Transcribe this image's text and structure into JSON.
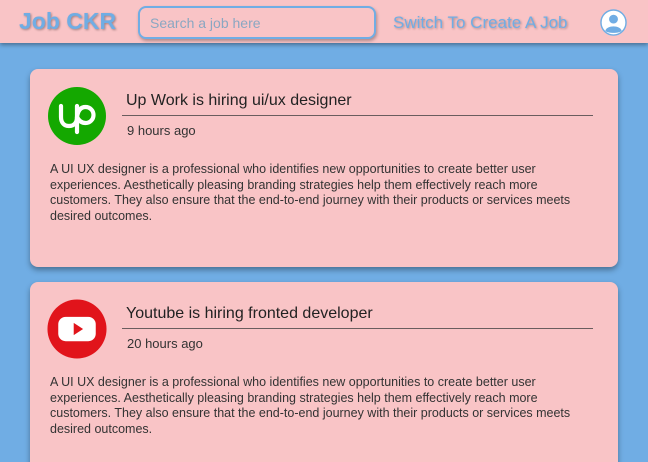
{
  "navbar": {
    "logo": "Job CKR",
    "search_placeholder": "Search a job here",
    "switch_link": "Switch To Create A Job",
    "avatar_icon": "user-avatar-icon"
  },
  "jobs": [
    {
      "company_logo": "upwork-logo",
      "logo_color": "#14a800",
      "title": "Up Work is hiring ui/ux designer",
      "posted": "9 hours ago",
      "description": "A UI UX designer is a professional who identifies new opportunities to create better user experiences. Aesthetically pleasing branding strategies help them effectively reach more customers. They also ensure that the end-to-end journey with their products or services meets desired outcomes."
    },
    {
      "company_logo": "youtube-logo",
      "logo_color": "#e1141b",
      "title": "Youtube is hiring fronted developer",
      "posted": "20 hours ago",
      "description": "A UI UX designer is a professional who identifies new opportunities to create better user experiences. Aesthetically pleasing branding strategies help them effectively reach more customers. They also ensure that the end-to-end journey with their products or services meets desired outcomes."
    }
  ],
  "colors": {
    "background": "#70ade4",
    "surface": "#f9c4c6",
    "accent": "#70ade4"
  }
}
